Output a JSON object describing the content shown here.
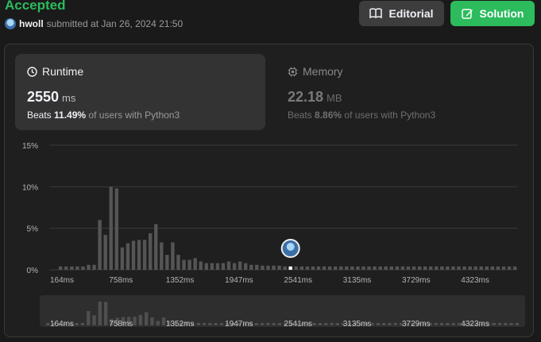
{
  "header": {
    "status": "Accepted",
    "username": "hwoll",
    "submitted_text": "submitted at Jan 26, 2024 21:50",
    "editorial_label": "Editorial",
    "solution_label": "Solution"
  },
  "runtime": {
    "title": "Runtime",
    "value": "2550",
    "unit": "ms",
    "beats_prefix": "Beats",
    "beats_percent": "11.49%",
    "beats_suffix": "of users with Python3"
  },
  "memory": {
    "title": "Memory",
    "value": "22.18",
    "unit": "MB",
    "beats_prefix": "Beats",
    "beats_percent": "8.86%",
    "beats_suffix": "of users with Python3"
  },
  "colors": {
    "accent_green": "#2cbb5d",
    "bar": "#555555",
    "bar_selected": "#ffffff",
    "grid": "#3a3a3a"
  },
  "chart_data": {
    "type": "bar",
    "xlabel": "",
    "ylabel": "",
    "ylim": [
      0,
      15
    ],
    "yticks": [
      "0%",
      "5%",
      "10%",
      "15%"
    ],
    "x_tick_labels": [
      "164ms",
      "758ms",
      "1352ms",
      "1947ms",
      "2541ms",
      "3135ms",
      "3729ms",
      "4323ms"
    ],
    "values": [
      0.4,
      0.4,
      0.4,
      0.4,
      0.4,
      0.6,
      0.6,
      6.0,
      4.2,
      10.0,
      9.8,
      2.7,
      3.2,
      3.5,
      3.6,
      3.6,
      4.4,
      5.5,
      3.3,
      1.8,
      3.3,
      1.8,
      1.2,
      1.2,
      1.4,
      1.0,
      0.8,
      0.8,
      0.8,
      0.8,
      1.0,
      0.8,
      1.0,
      0.8,
      0.6,
      0.6,
      0.5,
      0.5,
      0.5,
      0.5,
      0.4,
      0.4,
      0.4,
      0.4,
      0.4,
      0.4,
      0.4,
      0.4,
      0.4,
      0.4,
      0.4,
      0.4,
      0.4,
      0.4,
      0.4,
      0.4,
      0.4,
      0.4,
      0.4,
      0.4,
      0.4,
      0.4,
      0.4,
      0.4,
      0.4,
      0.4,
      0.4,
      0.4,
      0.4,
      0.4,
      0.4,
      0.4,
      0.4,
      0.4,
      0.4,
      0.4,
      0.4,
      0.4,
      0.4,
      0.4,
      0.4,
      0.4
    ],
    "selected_index": 41,
    "selected_value_ms": 2550,
    "brush_x_tick_labels": [
      "164ms",
      "758ms",
      "1352ms",
      "1947ms",
      "2541ms",
      "3135ms",
      "3729ms",
      "4323ms"
    ]
  }
}
